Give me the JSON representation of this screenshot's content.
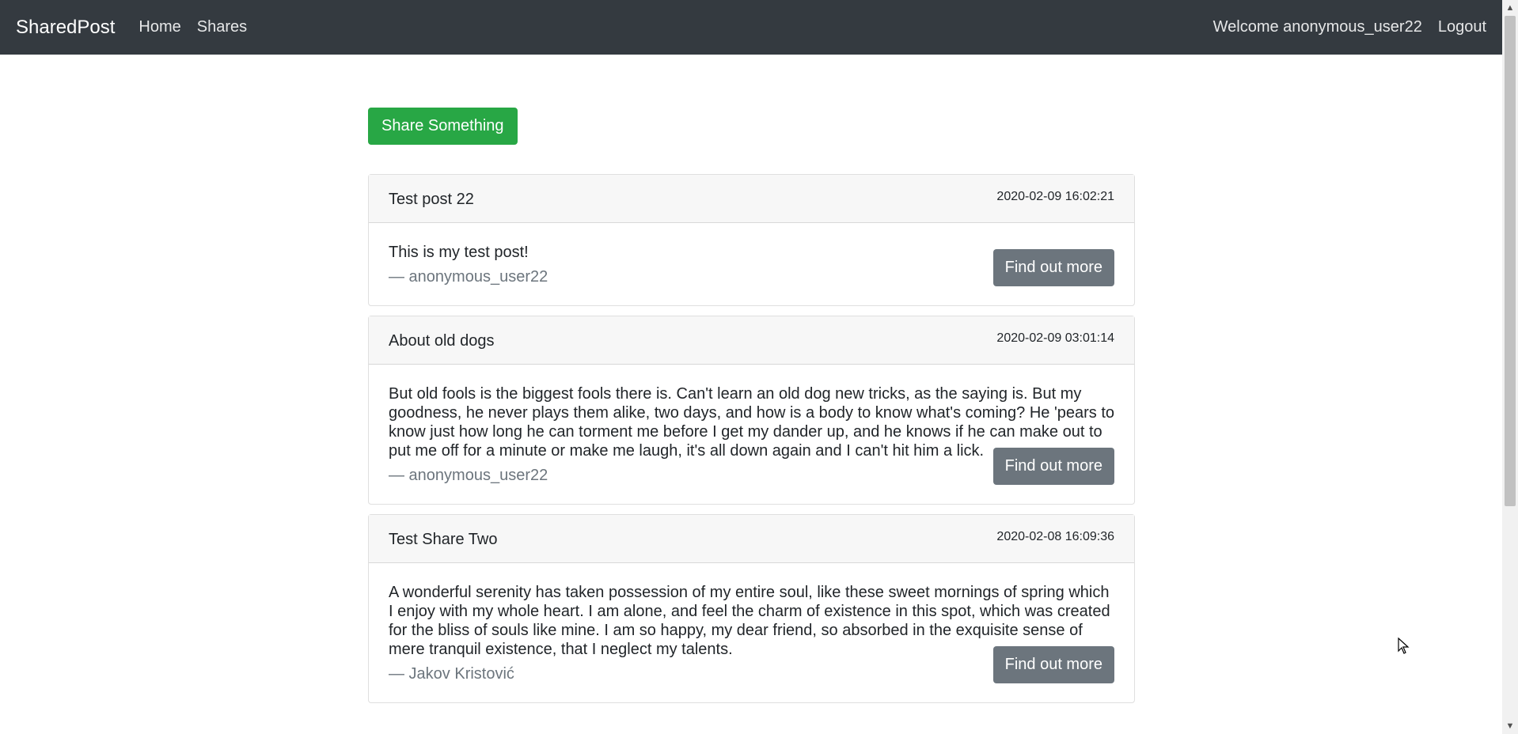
{
  "navbar": {
    "brand": "SharedPost",
    "links": [
      "Home",
      "Shares"
    ],
    "welcome": "Welcome anonymous_user22",
    "logout": "Logout"
  },
  "main": {
    "share_button": "Share Something",
    "posts": [
      {
        "title": "Test post 22",
        "date": "2020-02-09 16:02:21",
        "body": "This is my test post!",
        "author": "—  anonymous_user22",
        "button": "Find out more"
      },
      {
        "title": "About old dogs",
        "date": "2020-02-09 03:01:14",
        "body": "But old fools is the biggest fools there is. Can't learn an old dog new tricks, as the saying is. But my goodness, he never plays them alike, two days, and how is a body to know what's coming? He 'pears to know just how long he can torment me before I get my dander up, and he knows if he can make out to put me off for a minute or make me laugh, it's all down again and I can't hit him a lick.",
        "author": "—  anonymous_user22",
        "button": "Find out more"
      },
      {
        "title": "Test Share Two",
        "date": "2020-02-08 16:09:36",
        "body": "A wonderful serenity has taken possession of my entire soul, like these sweet mornings of spring which I enjoy with my whole heart. I am alone, and feel the charm of existence in this spot, which was created for the bliss of souls like mine. I am so happy, my dear friend, so absorbed in the exquisite sense of mere tranquil existence, that I neglect my talents.",
        "author": "—  Jakov Kristović",
        "button": "Find out more"
      }
    ]
  },
  "colors": {
    "navbar_bg": "#343a40",
    "success": "#28a745",
    "secondary": "#6c757d"
  },
  "icons": {
    "scroll_up": "chevron-up-icon",
    "scroll_down": "chevron-down-icon",
    "cursor": "mouse-pointer-icon"
  }
}
